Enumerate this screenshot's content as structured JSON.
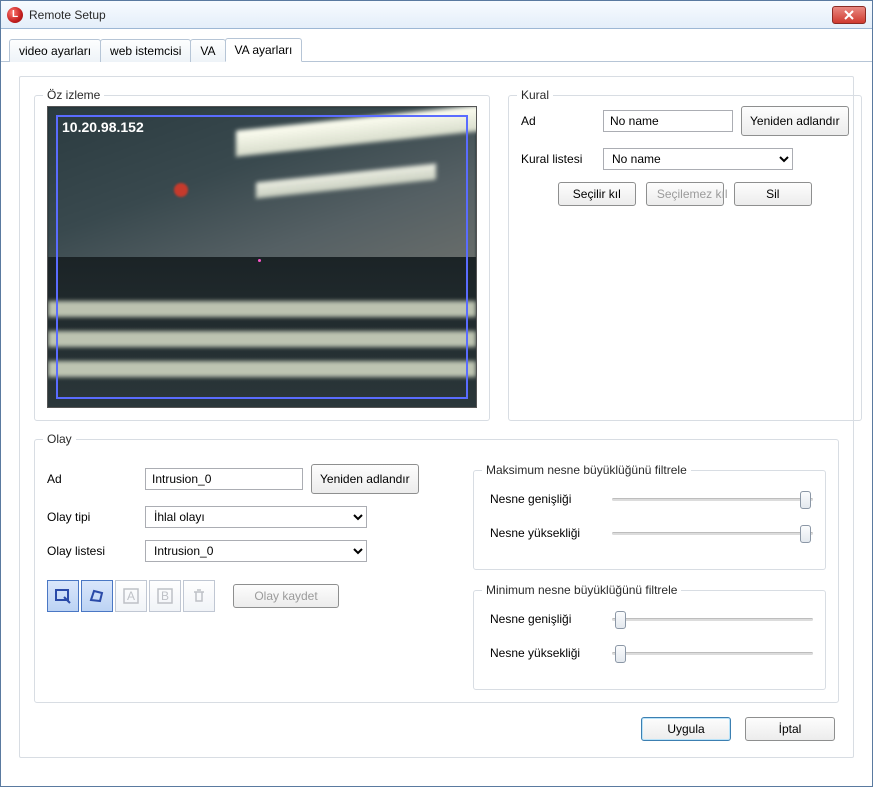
{
  "window": {
    "title": "Remote Setup"
  },
  "tabs": {
    "t0": "video ayarları",
    "t1": "web istemcisi",
    "t2": "VA",
    "t3": "VA ayarları",
    "active_index": 3
  },
  "preview": {
    "legend": "Öz izleme",
    "ip": "10.20.98.152"
  },
  "kural": {
    "legend": "Kural",
    "ad_label": "Ad",
    "ad_value": "No name",
    "rename_btn": "Yeniden adlandır",
    "list_label": "Kural listesi",
    "list_value": "No name",
    "btn_selectable": "Seçilir kıl",
    "btn_unselectable": "Seçilemez kıl",
    "btn_delete": "Sil"
  },
  "olay": {
    "legend": "Olay",
    "ad_label": "Ad",
    "ad_value": "Intrusion_0",
    "rename_btn": "Yeniden adlandır",
    "type_label": "Olay tipi",
    "type_value": "İhlal olayı",
    "list_label": "Olay listesi",
    "list_value": "Intrusion_0",
    "save_btn": "Olay kaydet"
  },
  "filter_max": {
    "legend": "Maksimum nesne büyüklüğünü filtrele",
    "width_label": "Nesne genişliği",
    "height_label": "Nesne yüksekliği",
    "width_pct": 96,
    "height_pct": 96
  },
  "filter_min": {
    "legend": "Minimum nesne büyüklüğünü filtrele",
    "width_label": "Nesne genişliği",
    "height_label": "Nesne yüksekliği",
    "width_pct": 4,
    "height_pct": 4
  },
  "footer": {
    "apply": "Uygula",
    "cancel": "İptal"
  }
}
